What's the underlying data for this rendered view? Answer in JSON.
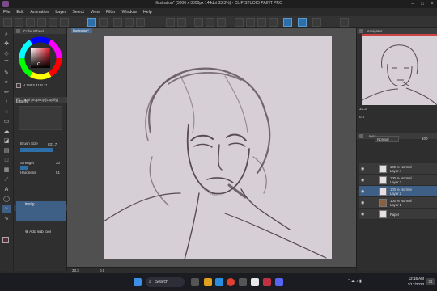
{
  "app": {
    "title": "Illustration* (3000 x 3000px 144dpi 33.3%) - CLIP STUDIO PAINT PRO"
  },
  "menu": [
    "File",
    "Edit",
    "Animation",
    "Layer",
    "Select",
    "View",
    "Filter",
    "Window",
    "Help"
  ],
  "document_tab": "Illustration*",
  "left_panel": {
    "color_wheel_tab": "Color Wheel",
    "hsv_readout": "H 358  S 41  B 21",
    "tool_property_tab": "Tool property [Liquify]",
    "tool_name": "Liquify",
    "brush_size_label": "Brush Size",
    "brush_size_value": "831.7",
    "strength_label": "Strength",
    "strength_value": "20",
    "hardness_label": "Hardness",
    "hardness_value": "51",
    "subtool_tab": "Sub Tool",
    "subtool_items": [
      "Liquify"
    ],
    "add_sub_tool": "Add sub tool"
  },
  "navigator": {
    "tab": "Navigator",
    "zoom": "33.3",
    "rotation": "0.0"
  },
  "layer_panel": {
    "tab": "Layer",
    "blend_mode": "Normal",
    "opacity": "100",
    "layers": [
      {
        "mode": "100 % Normal",
        "name": "Layer 4"
      },
      {
        "mode": "100 % Normal",
        "name": "Layer 3"
      },
      {
        "mode": "100 % Normal",
        "name": "Layer 2",
        "selected": true
      },
      {
        "mode": "100 % Normal",
        "name": "Layer 1"
      },
      {
        "mode": "",
        "name": "Paper"
      }
    ]
  },
  "status": {
    "zoom": "33.3",
    "rotation": "0.0"
  },
  "taskbar": {
    "search_label": "Search",
    "time": "12:15 AM",
    "date": "2/17/2023",
    "notification_count": "21"
  },
  "colors": {
    "accent": "#2d6fa8",
    "selection": "#3e5f86",
    "canvas": "#d6d0d6",
    "sketch": "#5a4a52"
  }
}
